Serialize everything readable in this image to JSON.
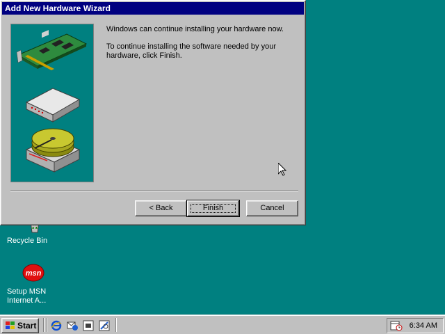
{
  "desktop": {
    "background_color": "#008080",
    "icons": [
      {
        "label": "Recycle Bin",
        "icon": "recycle-bin-icon"
      },
      {
        "label_line1": "Setup MSN",
        "label_line2": "Internet A...",
        "icon": "msn-icon",
        "badge": "msn"
      }
    ]
  },
  "wizard": {
    "title": "Add New Hardware Wizard",
    "line1": "Windows can continue installing your hardware now.",
    "line2": "To continue installing the software needed by your hardware, click Finish.",
    "buttons": {
      "back": "< Back",
      "finish": "Finish",
      "cancel": "Cancel"
    },
    "art": [
      "expansion-card-icon",
      "modem-icon",
      "hard-drive-icon"
    ],
    "title_color": "#000080"
  },
  "taskbar": {
    "start_label": "Start",
    "quick_launch": [
      "internet-explorer-icon",
      "outlook-express-icon",
      "show-desktop-icon",
      "channels-icon"
    ],
    "tray_icon": "scheduler-icon",
    "clock": "6:34 AM"
  }
}
